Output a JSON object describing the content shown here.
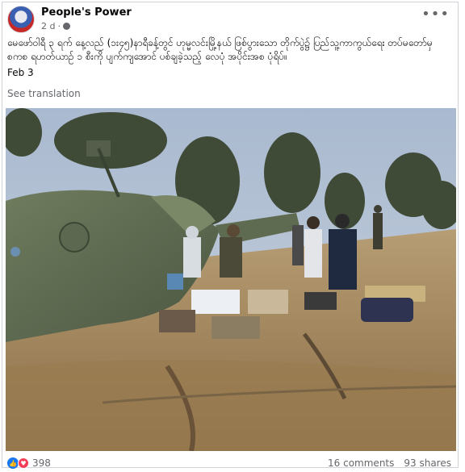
{
  "post": {
    "page_name": "People's Power",
    "time_ago": "2 d",
    "time_sep": "·",
    "text": "မေဖော်ဝါရီ ၃ ရက် နေ့လည် (၁း၄၅)နာရီခန့်တွင် ဟုမ္မလင်းမြို့နယ် ဖြစ်ပွားသော တိုက်ပွဲ၌ ပြည်သူ့ကာကွယ်ရေး တပ်မတော်မှ စကစ ရဟတ်ယာဉ် ၁ စီးကို ပျက်ကျအောင် ပစ်ချခဲ့သည့် လေပုံ အပိုင်းအစ ပုံရိပ်။",
    "date": "Feb 3",
    "see_translation": "See translation",
    "more_icon": "more-horizontal-icon"
  },
  "footer": {
    "reaction_count": "398",
    "comments": "16 comments",
    "shares": "93 shares",
    "like_color": "#1877f2",
    "love_color": "#f33e58"
  },
  "photo": {
    "description_icon": "photo"
  }
}
